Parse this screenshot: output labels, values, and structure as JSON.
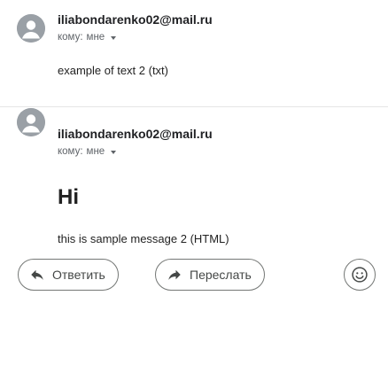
{
  "messages": [
    {
      "sender": "iliabondarenko02@mail.ru",
      "recipient_prefix": "кому:",
      "recipient_value": "мне",
      "body": "example of text 2 (txt)"
    },
    {
      "sender": "iliabondarenko02@mail.ru",
      "recipient_prefix": "кому:",
      "recipient_value": "мне",
      "heading": "Hi",
      "body": "this is sample message 2 (HTML)"
    }
  ],
  "actions": {
    "reply_label": "Ответить",
    "forward_label": "Переслать",
    "reply_icon": "reply-icon",
    "forward_icon": "forward-icon",
    "emoji_icon": "emoji-icon"
  },
  "colors": {
    "avatar": "#9aa0a6",
    "sender": "#202124",
    "secondary": "#5f6368"
  }
}
